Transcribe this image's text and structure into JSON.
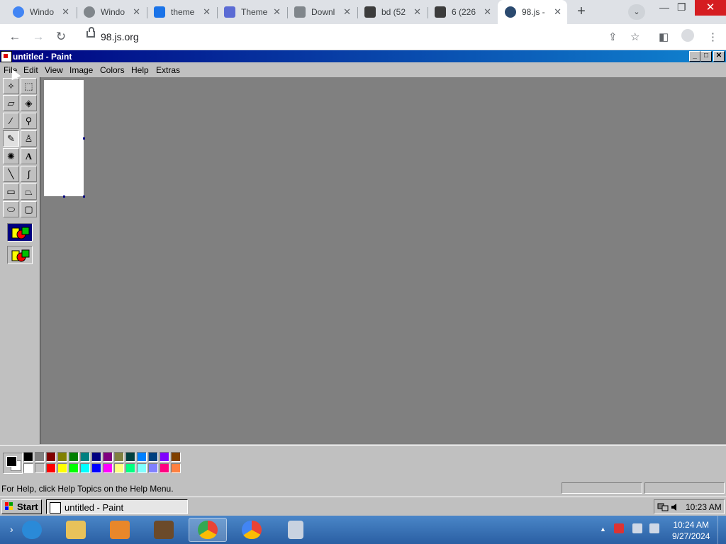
{
  "browser": {
    "tabs": [
      {
        "label": "Windo",
        "favicon_color": "#4285f4"
      },
      {
        "label": "Windo",
        "favicon_color": "#80868b"
      },
      {
        "label": "theme",
        "favicon_color": "#1a73e8"
      },
      {
        "label": "Theme",
        "favicon_color": "#5b6bd4"
      },
      {
        "label": "Downl",
        "favicon_color": "#80868b"
      },
      {
        "label": "bd (52",
        "favicon_color": "#3c3c3c"
      },
      {
        "label": "6 (226",
        "favicon_color": "#3c3c3c"
      },
      {
        "label": "98.js -",
        "favicon_color": "#2b4a6f"
      }
    ],
    "close_glyph": "✕",
    "new_tab_glyph": "+",
    "tab_search_glyph": "⌄",
    "window_controls": {
      "minimize": "—",
      "restore": "❐",
      "close": "✕"
    },
    "nav": {
      "back": "←",
      "forward": "→",
      "reload": "↻"
    },
    "url": "98.js.org",
    "toolbar_icons": {
      "share": "⇪",
      "bookmark": "☆",
      "side_panel": "◧",
      "profile": "●",
      "menu": "⋮"
    }
  },
  "paint": {
    "title": "untitled - Paint",
    "title_buttons": {
      "minimize": "_",
      "maximize": "□",
      "close": "✕"
    },
    "menu": [
      "File",
      "Edit",
      "View",
      "Image",
      "Colors",
      "Help",
      "Extras"
    ],
    "tools": [
      {
        "name": "free-form-select-tool",
        "glyph": "✧"
      },
      {
        "name": "select-tool",
        "glyph": "⬚"
      },
      {
        "name": "eraser-tool",
        "glyph": "▱"
      },
      {
        "name": "fill-tool",
        "glyph": "◈"
      },
      {
        "name": "pick-color-tool",
        "glyph": "⁄"
      },
      {
        "name": "magnifier-tool",
        "glyph": "⚲"
      },
      {
        "name": "pencil-tool",
        "glyph": "✎"
      },
      {
        "name": "brush-tool",
        "glyph": "♙"
      },
      {
        "name": "airbrush-tool",
        "glyph": "✺"
      },
      {
        "name": "text-tool",
        "glyph": "A"
      },
      {
        "name": "line-tool",
        "glyph": "╲"
      },
      {
        "name": "curve-tool",
        "glyph": "∫"
      },
      {
        "name": "rectangle-tool",
        "glyph": "▭"
      },
      {
        "name": "polygon-tool",
        "glyph": "⏢"
      },
      {
        "name": "ellipse-tool",
        "glyph": "⬭"
      },
      {
        "name": "rounded-rectangle-tool",
        "glyph": "▢"
      }
    ],
    "palette_top": [
      "#000000",
      "#808080",
      "#800000",
      "#808000",
      "#008000",
      "#008080",
      "#000080",
      "#800080",
      "#808040",
      "#004040",
      "#0080ff",
      "#004080",
      "#8000ff",
      "#804000"
    ],
    "palette_bottom": [
      "#ffffff",
      "#c0c0c0",
      "#ff0000",
      "#ffff00",
      "#00ff00",
      "#00ffff",
      "#0000ff",
      "#ff00ff",
      "#ffff80",
      "#00ff80",
      "#80ffff",
      "#8080ff",
      "#ff0080",
      "#ff8040"
    ],
    "foreground_color": "#000000",
    "background_color": "#ffffff",
    "status_text": "For Help, click Help Topics on the Help Menu."
  },
  "win98_taskbar": {
    "start_label": "Start",
    "task_label": "untitled - Paint",
    "clock": "10:23 AM"
  },
  "win7_taskbar": {
    "apps": [
      {
        "name": "internet-explorer",
        "color": "#2a8ad8"
      },
      {
        "name": "file-explorer",
        "color": "#e8c25a"
      },
      {
        "name": "media-player",
        "color": "#e8872a"
      },
      {
        "name": "archive-app",
        "color": "#6b4a2a"
      },
      {
        "name": "chrome",
        "color": "#34a853",
        "active": true
      },
      {
        "name": "chrome-alt",
        "color": "#4285f4"
      },
      {
        "name": "notepad-app",
        "color": "#c8d2e0"
      }
    ],
    "tray_arrow": "▲",
    "time": "10:24 AM",
    "date": "9/27/2024"
  }
}
